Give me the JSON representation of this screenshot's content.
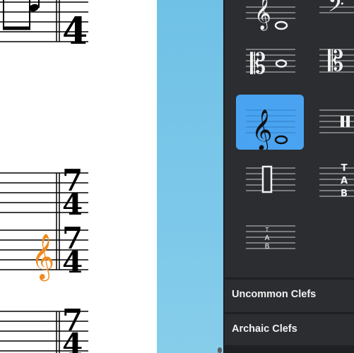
{
  "score": {
    "time_signatures": [
      {
        "numerator": "",
        "denominator": "4"
      },
      {
        "numerator": "7",
        "denominator": "4"
      },
      {
        "numerator": "7",
        "denominator": "4"
      },
      {
        "numerator": "7",
        "denominator": "4"
      }
    ],
    "highlight_color": "#f08a1c"
  },
  "clef_palette": {
    "items": [
      {
        "name": "treble-8vb-clef"
      },
      {
        "name": "bass-clef"
      },
      {
        "name": "alto-clef"
      },
      {
        "name": "tenor-clef"
      },
      {
        "name": "treble-clef",
        "selected": true
      },
      {
        "name": "percussion-clef"
      },
      {
        "name": "percussion-clef-2"
      },
      {
        "name": "tab-clef",
        "label": "TAB"
      },
      {
        "name": "tab-clef-small",
        "label": "TAB"
      }
    ],
    "selected_color": "#4aa3f0"
  },
  "sections": {
    "uncommon": "Uncommon Clefs",
    "archaic": "Archaic Clefs"
  }
}
